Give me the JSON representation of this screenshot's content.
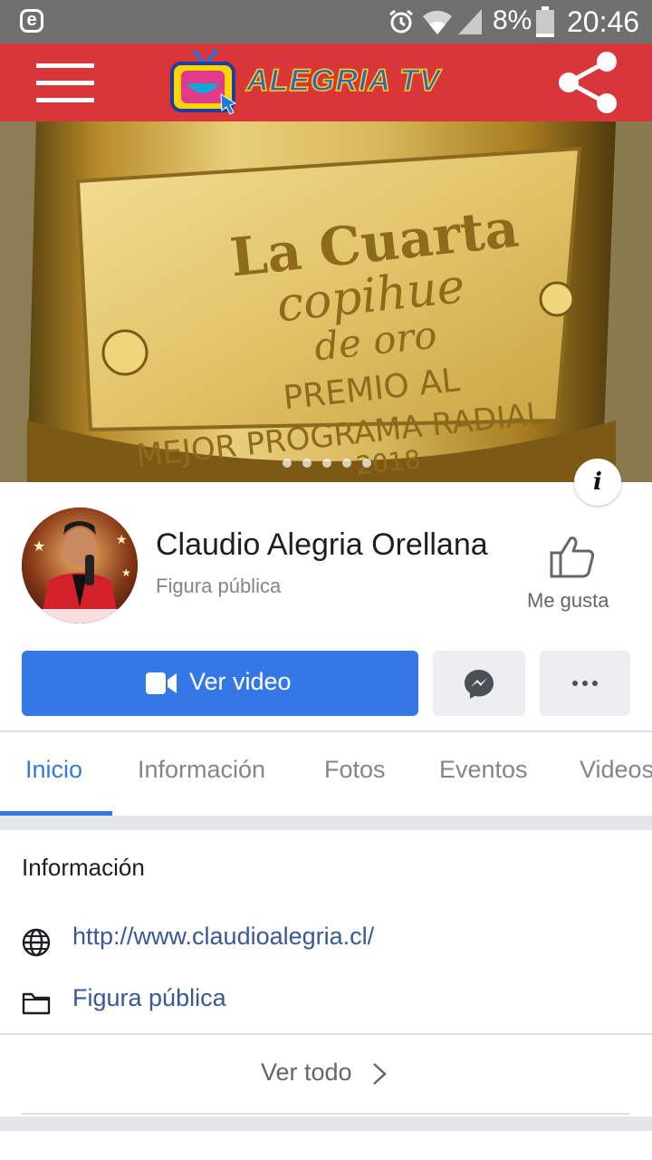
{
  "status_bar": {
    "app_icon": "e",
    "battery": "8%",
    "time": "20:46",
    "icons": [
      "alarm-icon",
      "wifi-icon",
      "signal-icon",
      "battery-icon"
    ]
  },
  "app_bar": {
    "title": "ALEGRIA TV",
    "menu_icon": "hamburger-icon",
    "share_icon": "share-icon",
    "color": "#d9363a"
  },
  "cover": {
    "plaque_line1": "La Cuarta",
    "plaque_line2": "copihue",
    "plaque_line3": "de oro",
    "plaque_line4": "PREMIO AL",
    "plaque_line5": "MEJOR PROGRAMA RADIAL",
    "plaque_year": "2018",
    "slide_count": 5,
    "info_label": "i"
  },
  "profile": {
    "name": "Claudio Alegria Orellana",
    "category": "Figura pública",
    "like_label": "Me gusta"
  },
  "actions": {
    "video_label": "Ver video",
    "accent": "#3578e5"
  },
  "tabs": [
    {
      "label": "Inicio",
      "active": true
    },
    {
      "label": "Información",
      "active": false
    },
    {
      "label": "Fotos",
      "active": false
    },
    {
      "label": "Eventos",
      "active": false
    },
    {
      "label": "Videos",
      "active": false
    }
  ],
  "info_section": {
    "title": "Información",
    "website": "http://www.claudioalegria.cl/",
    "category": "Figura pública",
    "see_all": "Ver todo"
  }
}
